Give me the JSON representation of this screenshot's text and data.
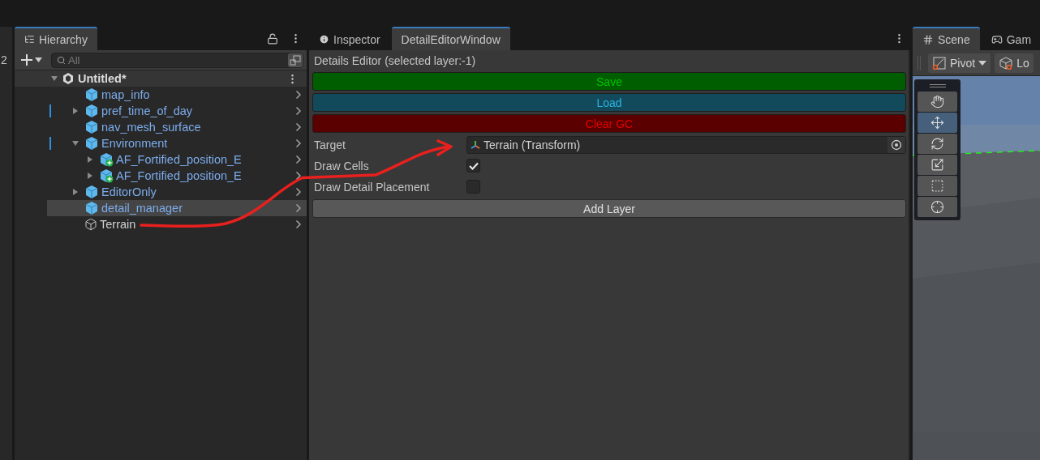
{
  "side_strip": {
    "label": "2"
  },
  "hierarchy": {
    "tab": {
      "label": "Hierarchy",
      "selected": true
    },
    "search": {
      "placeholder": "All"
    },
    "scene": {
      "label": "Untitled*",
      "expanded": true,
      "children": [
        {
          "label": "map_info",
          "kind": "prefab",
          "expandable": false,
          "overridden": false,
          "highlighted": false
        },
        {
          "label": "pref_time_of_day",
          "kind": "prefab",
          "expandable": true,
          "expanded": false,
          "overridden": true,
          "highlighted": false
        },
        {
          "label": "nav_mesh_surface",
          "kind": "prefab",
          "expandable": false,
          "overridden": false,
          "highlighted": false
        },
        {
          "label": "Environment",
          "kind": "prefab",
          "expandable": true,
          "expanded": true,
          "overridden": true,
          "highlighted": false,
          "children": [
            {
              "label": "AF_Fortified_position_E",
              "kind": "added",
              "expandable": true,
              "expanded": false,
              "overridden": false,
              "highlighted": false
            },
            {
              "label": "AF_Fortified_position_E",
              "kind": "added",
              "expandable": true,
              "expanded": false,
              "overridden": false,
              "highlighted": false
            }
          ]
        },
        {
          "label": "EditorOnly",
          "kind": "prefab",
          "expandable": true,
          "expanded": false,
          "overridden": false,
          "highlighted": false
        },
        {
          "label": "detail_manager",
          "kind": "prefab",
          "expandable": false,
          "overridden": false,
          "highlighted": true
        },
        {
          "label": "Terrain",
          "kind": "object",
          "expandable": false,
          "overridden": false,
          "highlighted": false
        }
      ]
    }
  },
  "editor": {
    "tabs": [
      {
        "label": "Inspector",
        "kind": "info",
        "selected": false
      },
      {
        "label": "DetailEditorWindow",
        "kind": "plain",
        "selected": true
      }
    ],
    "heading": "Details Editor (selected layer:-1)",
    "buttons": [
      {
        "label": "Save",
        "kind": "green"
      },
      {
        "label": "Load",
        "kind": "blue"
      },
      {
        "label": "Clear GC",
        "kind": "red"
      }
    ],
    "fields": [
      {
        "kind": "object",
        "label": "Target",
        "value": "Terrain (Transform)"
      },
      {
        "kind": "toggle",
        "label": "Draw Cells",
        "checked": true
      },
      {
        "kind": "toggle",
        "label": "Draw Detail Placement",
        "checked": false
      }
    ],
    "add_button": "Add Layer"
  },
  "scene": {
    "tabs": [
      {
        "label": "Scene",
        "kind": "grid",
        "selected": true
      },
      {
        "label": "Gam",
        "kind": "gamepad",
        "selected": false
      }
    ],
    "toolbar": [
      {
        "label": "Pivot",
        "kind": "pivot"
      },
      {
        "label": "Lo",
        "kind": "local"
      }
    ],
    "tools": [
      {
        "kind": "hand",
        "selected": false
      },
      {
        "kind": "move",
        "selected": true
      },
      {
        "kind": "rotate",
        "selected": false
      },
      {
        "kind": "scale",
        "selected": false
      },
      {
        "kind": "rect",
        "selected": false
      },
      {
        "kind": "transform",
        "selected": false
      }
    ]
  }
}
